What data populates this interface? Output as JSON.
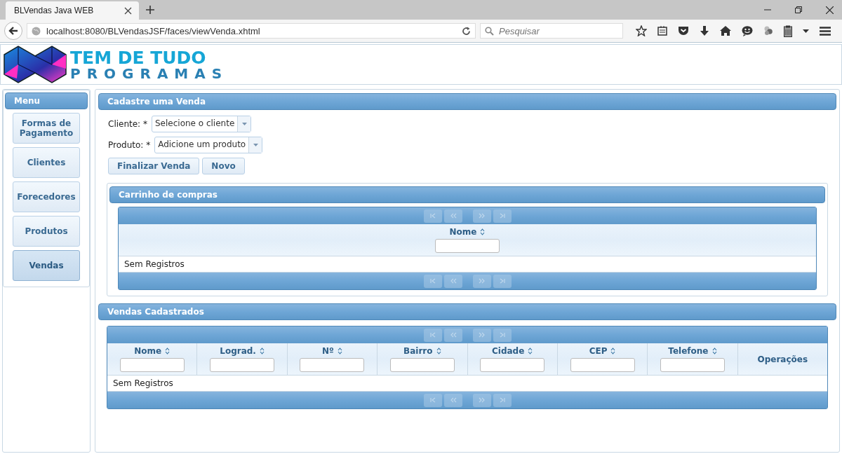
{
  "browser": {
    "tab_title": "BLVendas Java WEB",
    "url": "localhost:8080/BLVendasJSF/faces/viewVenda.xhtml",
    "search": {
      "placeholder": "Pesquisar"
    }
  },
  "logo": {
    "line_1": "TEM DE TUDO",
    "line_2": "PROGRAMAS"
  },
  "menu": {
    "title": "Menu",
    "items": [
      {
        "label": "Formas de Pagamento",
        "selected": false
      },
      {
        "label": "Clientes",
        "selected": false
      },
      {
        "label": "Forecedores",
        "selected": false
      },
      {
        "label": "Produtos",
        "selected": false
      },
      {
        "label": "Vendas",
        "selected": true
      }
    ]
  },
  "form": {
    "title": "Cadastre uma Venda",
    "fields": [
      {
        "label": "Cliente: *",
        "value": "Selecione o cliente"
      },
      {
        "label": "Produto: *",
        "value": "Adicione um produto"
      }
    ],
    "buttons": [
      "Finalizar Venda",
      "Novo"
    ]
  },
  "cart": {
    "title": "Carrinho de compras",
    "paginator_disabled": true,
    "columns": [
      {
        "label": "Nome",
        "sortable": true,
        "filter": true
      }
    ],
    "empty_message": "Sem Registros"
  },
  "sales": {
    "title": "Vendas Cadastrados",
    "paginator_disabled": true,
    "columns": [
      {
        "label": "Nome",
        "sortable": true,
        "filter": true
      },
      {
        "label": "Lograd.",
        "sortable": true,
        "filter": true
      },
      {
        "label": "Nº",
        "sortable": true,
        "filter": true
      },
      {
        "label": "Bairro",
        "sortable": true,
        "filter": true
      },
      {
        "label": "Cidade",
        "sortable": true,
        "filter": true
      },
      {
        "label": "CEP",
        "sortable": true,
        "filter": true
      },
      {
        "label": "Telefone",
        "sortable": true,
        "filter": true
      },
      {
        "label": "Operações",
        "sortable": false,
        "filter": false
      }
    ],
    "empty_message": "Sem Registros"
  }
}
